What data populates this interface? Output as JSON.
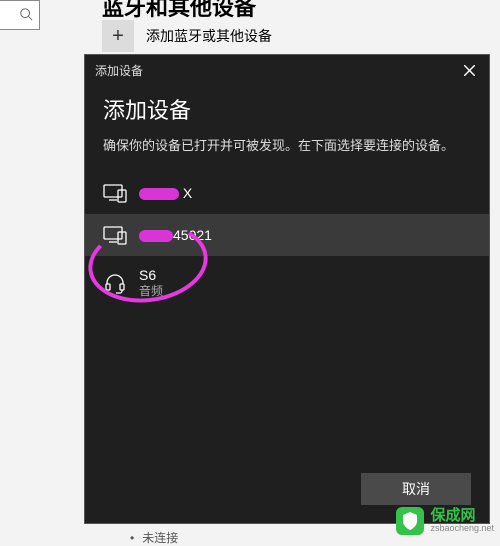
{
  "background": {
    "title_cut": "蓝牙和其他设备",
    "add_label": "添加蓝牙或其他设备",
    "plus": "+",
    "status_icon": "•",
    "status_text": "未连接"
  },
  "dialog": {
    "titlebar": "添加设备",
    "heading": "添加设备",
    "subtext": "确保你的设备已打开并可被发现。在下面选择要连接的设备。",
    "devices": [
      {
        "name_suffix": " X",
        "subtitle": ""
      },
      {
        "name_suffix": "45021",
        "subtitle": ""
      },
      {
        "name": "S6",
        "subtitle": "音频"
      }
    ],
    "cancel": "取消"
  },
  "watermark": {
    "brand": "保成网",
    "url": "zsbaocheng.net"
  }
}
